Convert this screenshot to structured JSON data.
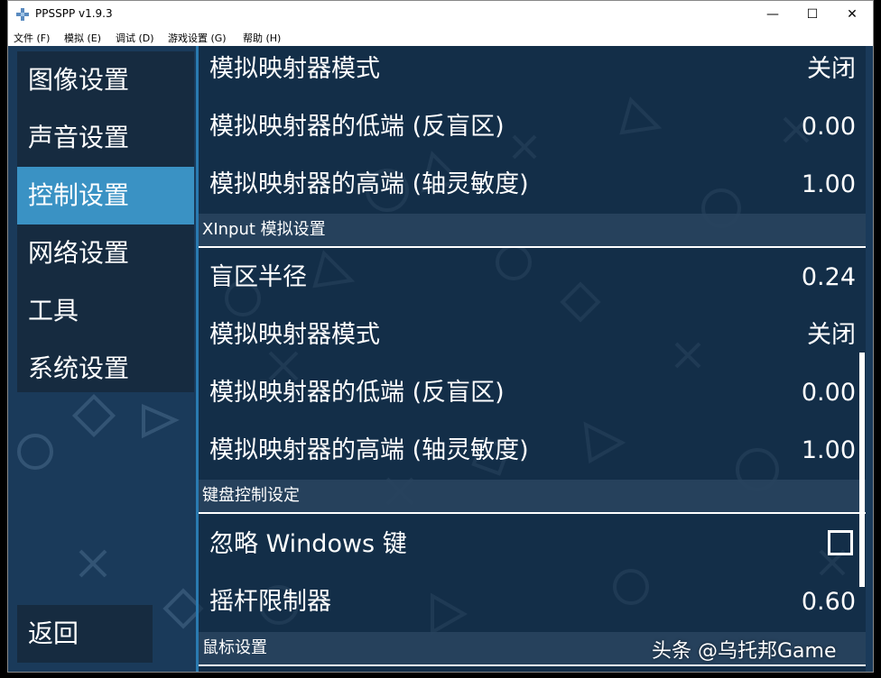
{
  "window": {
    "title": "PPSSPP v1.9.3",
    "controls": {
      "minimize": "—",
      "maximize": "☐",
      "close": "✕"
    },
    "menu": [
      "文件 (F)",
      "模拟 (E)",
      "调试 (D)",
      "游戏设置 (G)",
      "帮助 (H)"
    ]
  },
  "sidebar": {
    "items": [
      "图像设置",
      "声音设置",
      "控制设置",
      "网络设置",
      "工具",
      "系统设置"
    ],
    "active_index": 2,
    "back_label": "返回"
  },
  "content": {
    "group1_rows": [
      {
        "label": "模拟映射器模式",
        "value": "关闭"
      },
      {
        "label": "模拟映射器的低端 (反盲区)",
        "value": "0.00"
      },
      {
        "label": "模拟映射器的高端 (轴灵敏度)",
        "value": "1.00"
      }
    ],
    "xinput_header": "XInput 模拟设置",
    "xinput_rows": [
      {
        "label": "盲区半径",
        "value": "0.24"
      },
      {
        "label": "模拟映射器模式",
        "value": "关闭"
      },
      {
        "label": "模拟映射器的低端 (反盲区)",
        "value": "0.00"
      },
      {
        "label": "模拟映射器的高端 (轴灵敏度)",
        "value": "1.00"
      }
    ],
    "keyboard_header": "键盘控制设定",
    "keyboard_rows": [
      {
        "label": "忽略 Windows 键",
        "checked": false
      },
      {
        "label": "摇杆限制器",
        "value": "0.60"
      }
    ],
    "mouse_header": "鼠标设置"
  },
  "watermark": "头条 @乌托邦Game",
  "colors": {
    "background": "#1a3a5a",
    "active": "#3a92c4",
    "panel": "#162a3e"
  }
}
